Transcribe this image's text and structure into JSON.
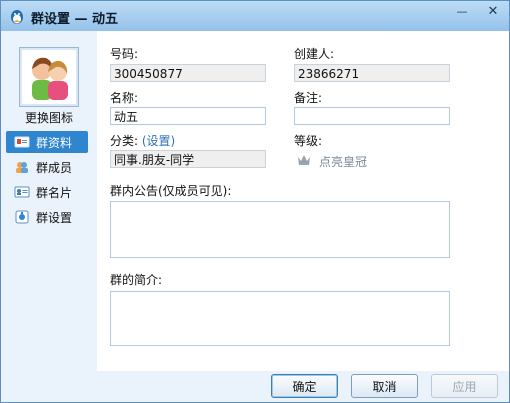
{
  "window": {
    "title": "群设置 — 动五",
    "minimize_label": "—",
    "close_label": "✕"
  },
  "sidebar": {
    "change_icon_label": "更换图标",
    "items": [
      {
        "label": "群资料",
        "icon": "profile-card-icon"
      },
      {
        "label": "群成员",
        "icon": "members-icon"
      },
      {
        "label": "群名片",
        "icon": "name-card-icon"
      },
      {
        "label": "群设置",
        "icon": "settings-icon"
      }
    ]
  },
  "form": {
    "number_label": "号码:",
    "number_value": "300450877",
    "creator_label": "创建人:",
    "creator_value": "23866271",
    "name_label": "名称:",
    "name_value": "动五",
    "note_label": "备注:",
    "note_value": "",
    "category_label": "分类:",
    "category_link": "(设置)",
    "category_value": "同事.朋友-同学",
    "level_label": "等级:",
    "level_link": "点亮皇冠",
    "announcement_label": "群内公告(仅成员可见):",
    "announcement_value": "",
    "intro_label": "群的简介:",
    "intro_value": ""
  },
  "footer": {
    "ok": "确定",
    "cancel": "取消",
    "apply": "应用"
  },
  "colors": {
    "accent": "#2f86cf",
    "link": "#2d6fb8",
    "titlebar": "#95c2ea"
  }
}
